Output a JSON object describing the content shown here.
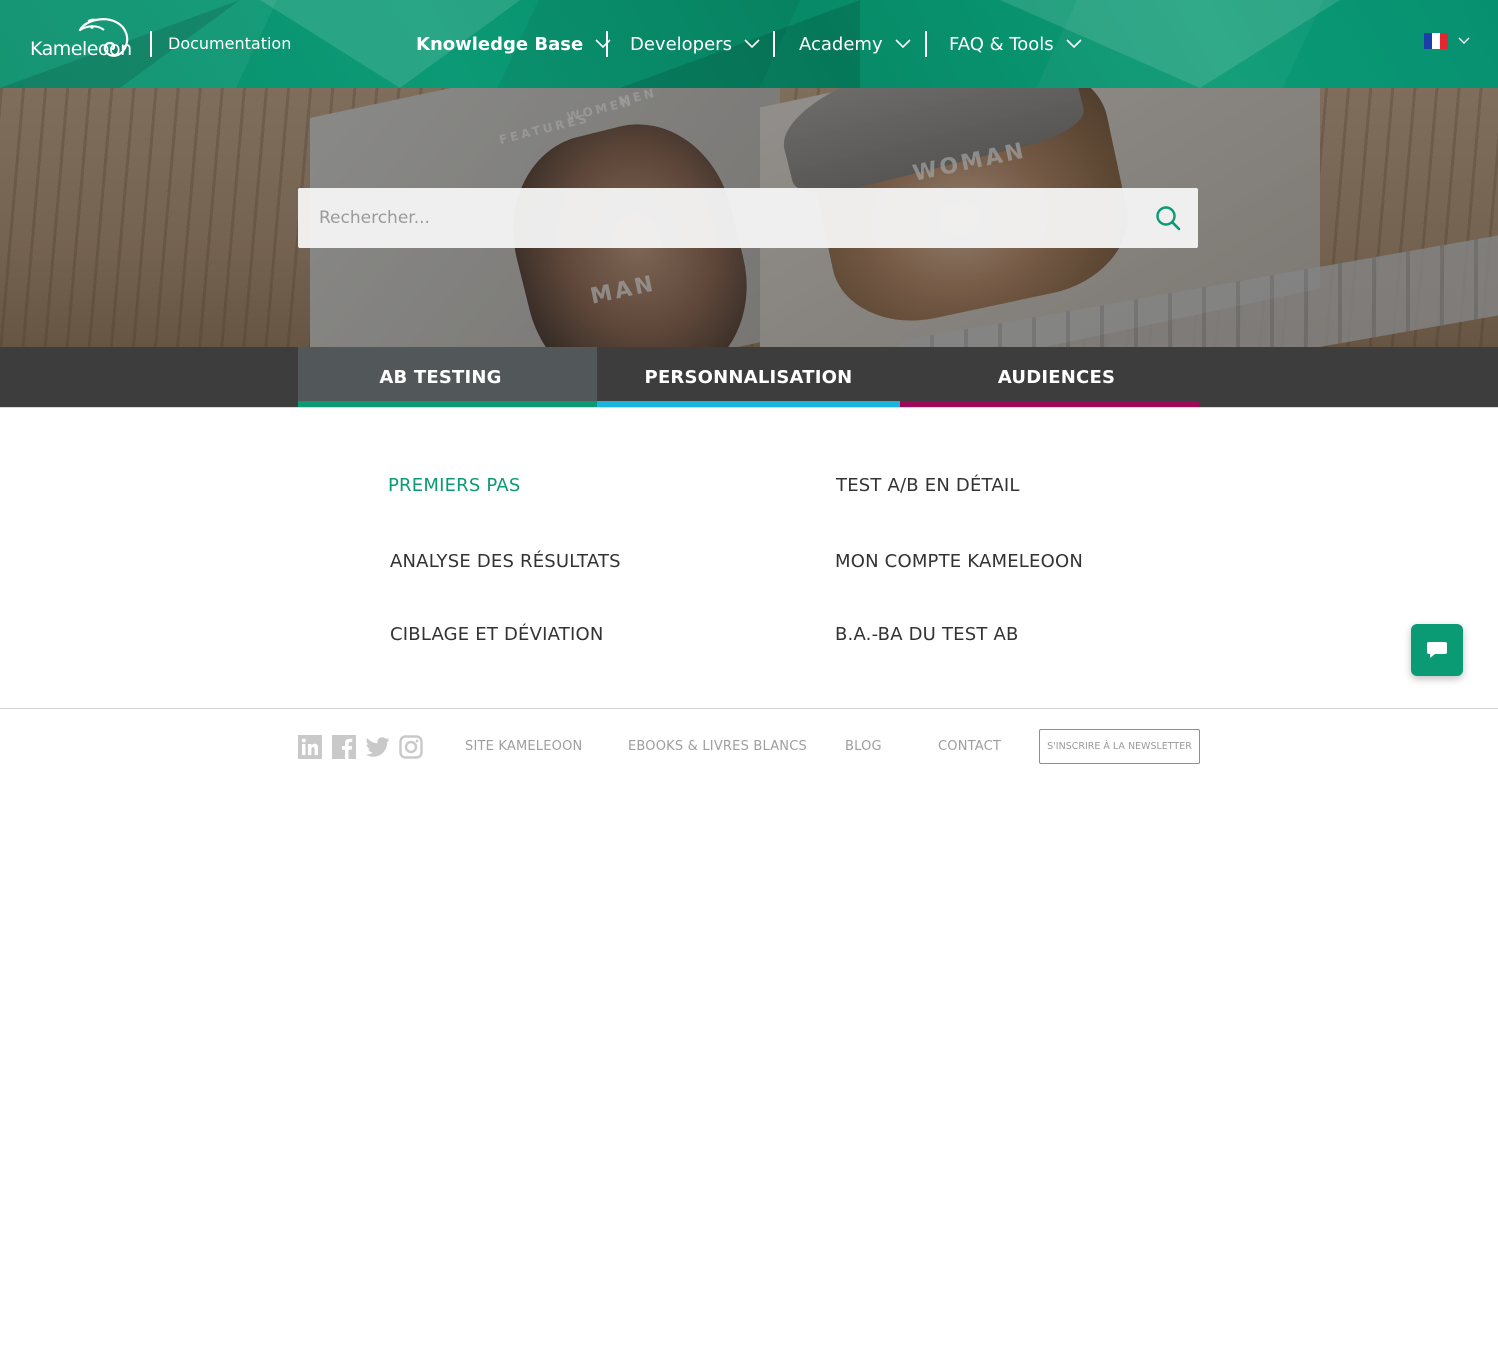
{
  "brand": {
    "logo_text": "Kameleoon",
    "section_label": "Documentation",
    "accent_color": "#0a9a74"
  },
  "nav": {
    "items": [
      {
        "label": "Knowledge Base",
        "active": true
      },
      {
        "label": "Developers",
        "active": false
      },
      {
        "label": "Academy",
        "active": false
      },
      {
        "label": "FAQ & Tools",
        "active": false
      }
    ],
    "language": {
      "flag": "fr-flag-icon",
      "current": "fr"
    }
  },
  "hero": {
    "search": {
      "placeholder": "Rechercher...",
      "value": ""
    },
    "image_words": [
      "FEATURES",
      "WOMEN",
      "MEN",
      "WOMAN",
      "MAN"
    ]
  },
  "tabs": [
    {
      "label": "AB TESTING",
      "active": true,
      "color": "#0a9a74"
    },
    {
      "label": "PERSONNALISATION",
      "active": false,
      "color": "#1ab5dd"
    },
    {
      "label": "AUDIENCES",
      "active": false,
      "color": "#9c0b5a"
    }
  ],
  "categories": [
    {
      "label": "PREMIERS PAS",
      "active": true
    },
    {
      "label": "TEST A/B EN DÉTAIL",
      "active": false
    },
    {
      "label": "ANALYSE DES RÉSULTATS",
      "active": false
    },
    {
      "label": "MON COMPTE KAMELEOON",
      "active": false
    },
    {
      "label": "CIBLAGE ET DÉVIATION",
      "active": false
    },
    {
      "label": "B.A.-BA DU TEST AB",
      "active": false
    }
  ],
  "footer": {
    "social": [
      "linkedin-icon",
      "facebook-icon",
      "twitter-icon",
      "instagram-icon"
    ],
    "links": [
      "SITE KAMELEOON",
      "EBOOKS & LIVRES BLANCS",
      "BLOG",
      "CONTACT"
    ],
    "newsletter_label": "S'INSCRIRE À LA NEWSLETTER"
  },
  "chat": {
    "icon": "chat-bubble-icon"
  }
}
